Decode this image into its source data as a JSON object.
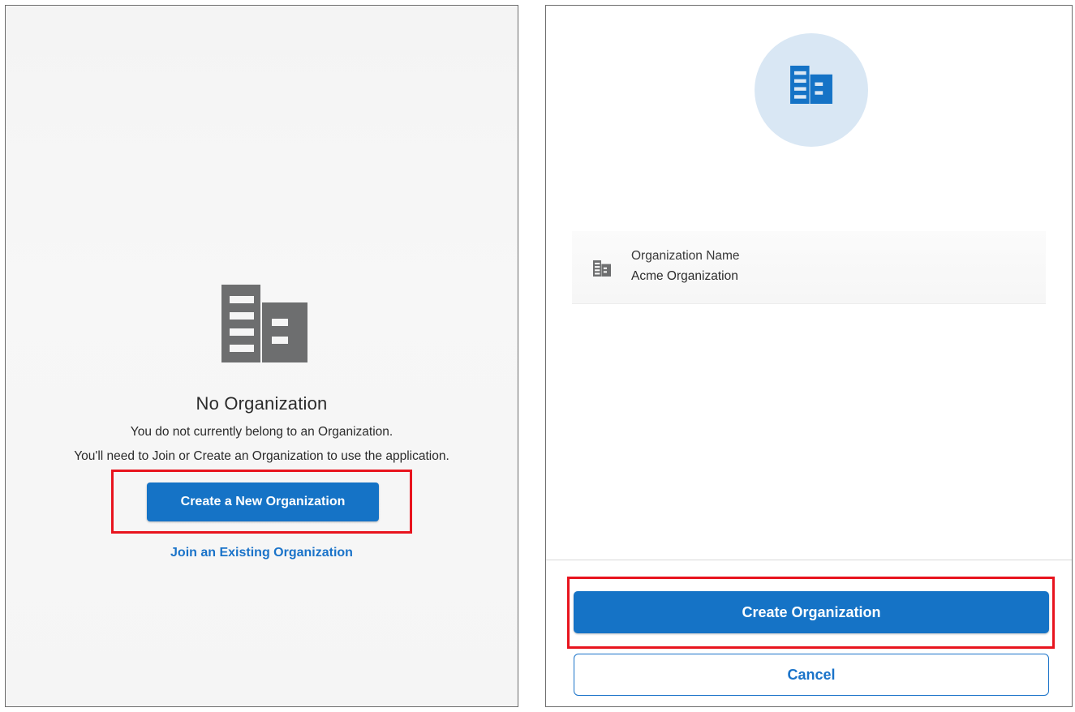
{
  "no_org_screen": {
    "title": "No Organization",
    "message_line_1": "You do not currently belong to an Organization.",
    "message_line_2": "You'll need to Join or Create an Organization to use the application.",
    "create_button_label": "Create a New Organization",
    "join_link_label": "Join an Existing Organization",
    "icon": "building-icon",
    "icon_color": "#6d6e6f"
  },
  "create_org_screen": {
    "avatar_icon": "building-icon",
    "avatar_bg_color": "#d9e7f4",
    "avatar_icon_color": "#1573c6",
    "field": {
      "icon": "building-icon",
      "label": "Organization Name",
      "value": "Acme Organization"
    },
    "create_button_label": "Create Organization",
    "cancel_button_label": "Cancel"
  },
  "colors": {
    "primary": "#1573c6",
    "highlight": "#e8141e"
  }
}
